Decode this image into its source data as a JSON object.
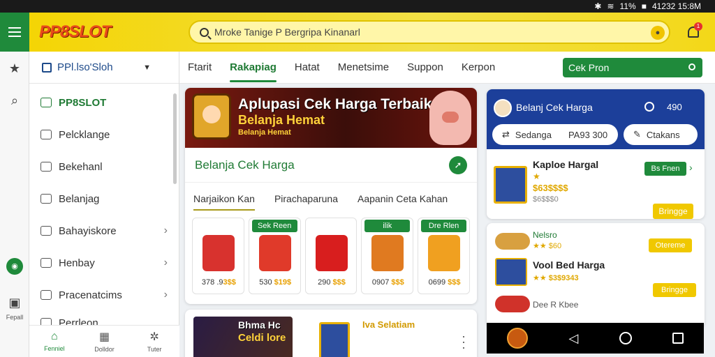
{
  "status": {
    "battery": "11%",
    "time": "41232 15:8M"
  },
  "header": {
    "logo": "PP8SLOT",
    "search_placeholder": "Mroke Tanige P Bergripa Kinanarl",
    "mic_icon": "●",
    "notif_count": "1"
  },
  "rail": {
    "label": "Fepall"
  },
  "sidebar": {
    "header": "PPl.lso'Sloh",
    "items": [
      {
        "label": "PP8SLOT"
      },
      {
        "label": "Pelcklange"
      },
      {
        "label": "Bekehanl"
      },
      {
        "label": "Belanjag"
      },
      {
        "label": "Bahayiskore"
      },
      {
        "label": "Henbay"
      },
      {
        "label": "Pracenatcims"
      },
      {
        "label": "Perrleon"
      }
    ],
    "bottom_nav": [
      {
        "label": "Fenniel"
      },
      {
        "label": "Dolldor"
      },
      {
        "label": "Tuter"
      }
    ]
  },
  "tabs": {
    "items": [
      {
        "label": "Ftarit"
      },
      {
        "label": "Rakapiag"
      },
      {
        "label": "Hatat"
      },
      {
        "label": "Menetsime"
      },
      {
        "label": "Suppon"
      },
      {
        "label": "Kerpon"
      }
    ],
    "cta": "Cek Pron"
  },
  "banner": {
    "title": "Aplupasi Cek Harga Terbaik",
    "subtitle": "Belanja Hemat",
    "small": "Belanja Hemat"
  },
  "section": {
    "title": "Belanja Cek Harga",
    "subtabs": [
      "Narjaikon Kan",
      "Pirachaparuna",
      "Aapanin Ceta Kahan"
    ],
    "products": [
      {
        "tag": "",
        "price": "378 .9",
        "price_hl": "3$$",
        "color": "#d8322e"
      },
      {
        "tag": "Sek Reen",
        "price": "530 ",
        "price_hl": "$19$",
        "color": "#e03a2a"
      },
      {
        "tag": "",
        "price": "290 ",
        "price_hl": "$$$",
        "color": "#d81e1e"
      },
      {
        "tag": "ilik",
        "price": "0907 ",
        "price_hl": "$$$",
        "color": "#e07a20"
      },
      {
        "tag": "Dre Rlen",
        "price": "0699 ",
        "price_hl": "$$$",
        "color": "#f0a020"
      }
    ]
  },
  "card2": {
    "title": "Bhma Hc",
    "subtitle": "Celdi lore",
    "label": "Iva Selatiam"
  },
  "right": {
    "title": "Belanj Cek Harga",
    "count": "490",
    "chip1": "Sedanga",
    "chip1_value": "PA93 300",
    "chip2": "Ctakans",
    "item": {
      "name": "Kaploe Hargal",
      "price": "$63$$$$",
      "old": "$6$$$0",
      "btn": "Bs Fnen",
      "buy": "Bringge"
    },
    "list": [
      {
        "name": "Nelsro",
        "star": "$60",
        "btn": "Otereme"
      },
      {
        "name": "Vool Bed Harga",
        "star": "$3$9343",
        "btn": "Bringge"
      },
      {
        "name": "Dee R Kbee",
        "star": "",
        "btn": ""
      }
    ]
  }
}
